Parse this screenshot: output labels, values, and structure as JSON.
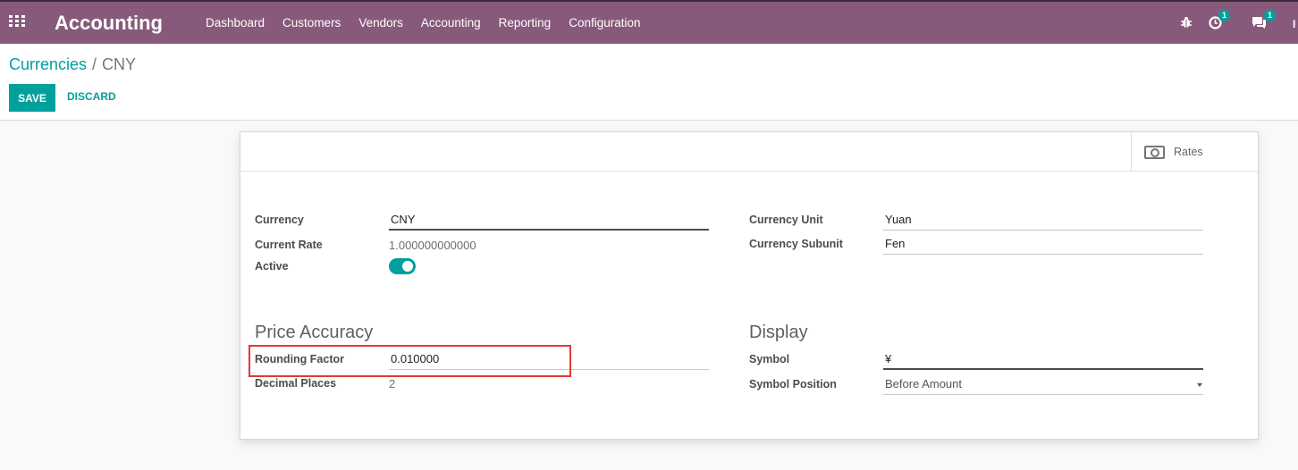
{
  "navbar": {
    "app_title": "Accounting",
    "menu": [
      "Dashboard",
      "Customers",
      "Vendors",
      "Accounting",
      "Reporting",
      "Configuration"
    ],
    "activities_count": "1",
    "messages_count": "1",
    "user_initial_truncated": "I"
  },
  "breadcrumb": {
    "parent": "Currencies",
    "separator": "/",
    "current": "CNY"
  },
  "actions": {
    "save": "SAVE",
    "discard": "DISCARD"
  },
  "smart_buttons": {
    "rates": "Rates"
  },
  "form": {
    "currency_label": "Currency",
    "currency_value": "CNY",
    "current_rate_label": "Current Rate",
    "current_rate_value": "1.000000000000",
    "active_label": "Active",
    "active_value": true,
    "currency_unit_label": "Currency Unit",
    "currency_unit_value": "Yuan",
    "currency_subunit_label": "Currency Subunit",
    "currency_subunit_value": "Fen",
    "price_accuracy_title": "Price Accuracy",
    "rounding_factor_label": "Rounding Factor",
    "rounding_factor_value": "0.010000",
    "decimal_places_label": "Decimal Places",
    "decimal_places_value": "2",
    "display_title": "Display",
    "symbol_label": "Symbol",
    "symbol_value": "¥",
    "symbol_position_label": "Symbol Position",
    "symbol_position_value": "Before Amount"
  },
  "colors": {
    "navbar": "#875a7b",
    "accent": "#00a09d",
    "highlight_box": "#e53935"
  }
}
